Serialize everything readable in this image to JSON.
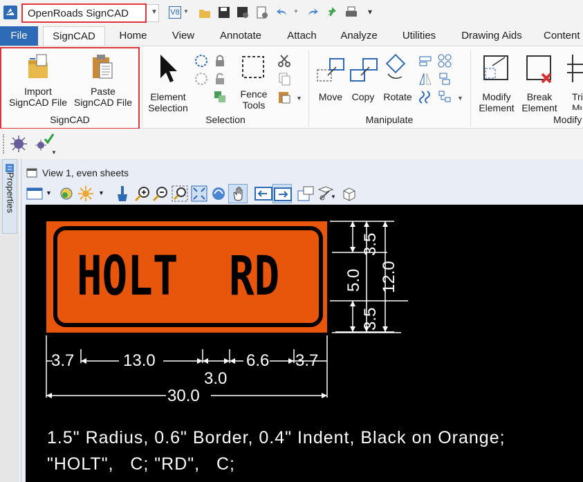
{
  "quick_access": {
    "workflow_selected": "OpenRoads SignCAD",
    "version_badge": "V8"
  },
  "ribbon_tabs": [
    "File",
    "SignCAD",
    "Home",
    "View",
    "Annotate",
    "Attach",
    "Analyze",
    "Utilities",
    "Drawing Aids",
    "Content"
  ],
  "groups": {
    "signcad": {
      "label": "SignCAD",
      "import_line1": "Import",
      "import_line2": "SignCAD File",
      "paste_line1": "Paste",
      "paste_line2": "SignCAD File"
    },
    "selection": {
      "label": "Selection",
      "element_line1": "Element",
      "element_line2": "Selection",
      "fence_line1": "Fence",
      "fence_line2": "Tools"
    },
    "manipulate": {
      "label": "Manipulate",
      "move": "Move",
      "copy": "Copy",
      "rotate": "Rotate"
    },
    "modify": {
      "label": "Modify",
      "modify_line1": "Modify",
      "modify_line2": "Element",
      "break_line1": "Break",
      "break_line2": "Element",
      "tri_line1": "Tri",
      "tri_line2": "Mult"
    }
  },
  "side_panel": {
    "properties": "Properties"
  },
  "view": {
    "title": "View 1, even sheets"
  },
  "sign": {
    "word1": "HOLT",
    "word2": "RD",
    "dims_right": {
      "top": "3.5",
      "middle": "5.0",
      "bottom": "3.5",
      "total": "12.0"
    },
    "dims_bottom": {
      "a": "3.7",
      "b": "13.0",
      "c": "6.6",
      "d": "3.7",
      "gap": "3.0",
      "total": "30.0"
    },
    "note_line1": "1.5\" Radius, 0.6\" Border, 0.4\" Indent, Black on Orange;",
    "note_line2": "\"HOLT\",   C; \"RD\",   C;"
  },
  "colors": {
    "accent": "#2d6ab5",
    "highlight": "#e0343a",
    "sign_orange": "#e8560b"
  }
}
